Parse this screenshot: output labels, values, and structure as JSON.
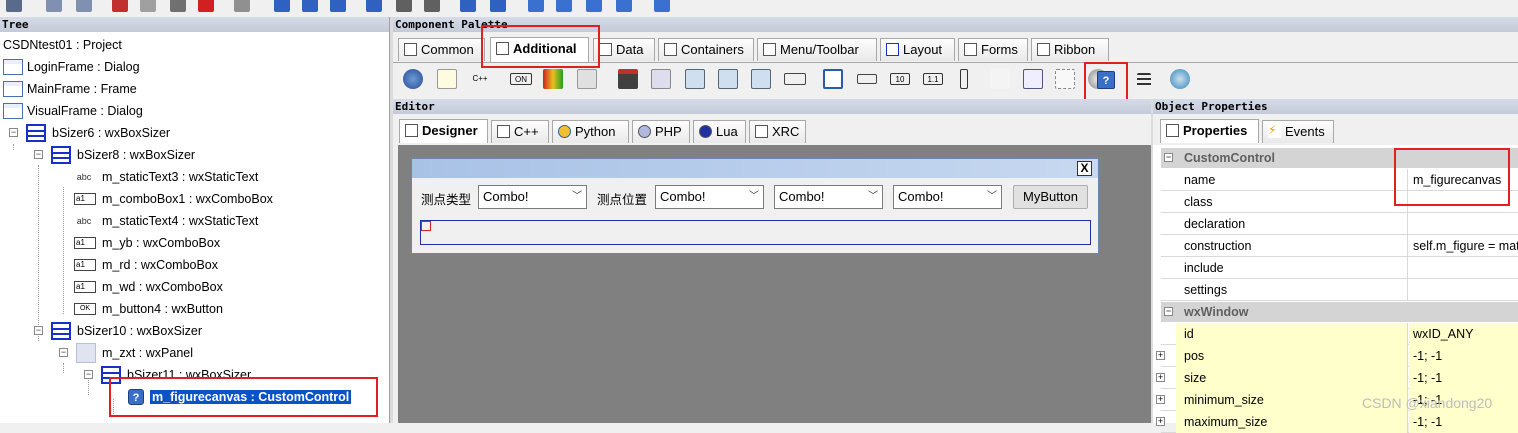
{
  "tree": {
    "header": "Tree",
    "rows": [
      {
        "label": "CSDNtest01 : Project"
      },
      {
        "label": "LoginFrame : Dialog"
      },
      {
        "label": "MainFrame : Frame"
      },
      {
        "label": "VisualFrame : Dialog"
      },
      {
        "label": "bSizer6 : wxBoxSizer"
      },
      {
        "label": "bSizer8 : wxBoxSizer"
      },
      {
        "label": "m_staticText3 : wxStaticText",
        "icon_text": "abc"
      },
      {
        "label": "m_comboBox1 : wxComboBox",
        "icon_text": "a1"
      },
      {
        "label": "m_staticText4 : wxStaticText",
        "icon_text": "abc"
      },
      {
        "label": "m_yb : wxComboBox",
        "icon_text": "a1"
      },
      {
        "label": "m_rd : wxComboBox",
        "icon_text": "a1"
      },
      {
        "label": "m_wd : wxComboBox",
        "icon_text": "a1"
      },
      {
        "label": "m_button4 : wxButton",
        "icon_text": "OK"
      },
      {
        "label": "bSizer10 : wxBoxSizer"
      },
      {
        "label": "m_zxt : wxPanel"
      },
      {
        "label": "bSizer11 : wxBoxSizer"
      },
      {
        "label": "m_figurecanvas : CustomControl"
      }
    ]
  },
  "palette": {
    "header": "Component Palette",
    "tabs": [
      "Common",
      "Additional",
      "Data",
      "Containers",
      "Menu/Toolbar",
      "Layout",
      "Forms",
      "Ribbon"
    ],
    "active_tab": "Additional",
    "small_icon_text": {
      "cpp": "C++",
      "on": "ON",
      "ten": "10",
      "one_one": "1.1"
    }
  },
  "editor": {
    "header": "Editor",
    "tabs": [
      "Designer",
      "C++",
      "Python",
      "PHP",
      "Lua",
      "XRC"
    ],
    "active_tab": "Designer",
    "form": {
      "close_glyph": "X",
      "label1": "测点类型",
      "label2": "测点位置",
      "combo1": "Combo!",
      "combo2": "Combo!",
      "combo3": "Combo!",
      "combo4": "Combo!",
      "button": "MyButton"
    }
  },
  "properties": {
    "header": "Object Properties",
    "tabs": [
      "Properties",
      "Events"
    ],
    "categories": [
      {
        "name": "CustomControl",
        "rows": [
          {
            "key": "name",
            "value": "m_figurecanvas"
          },
          {
            "key": "class",
            "value": ""
          },
          {
            "key": "declaration",
            "value": ""
          },
          {
            "key": "construction",
            "value": "self.m_figure = mat"
          },
          {
            "key": "include",
            "value": ""
          },
          {
            "key": "settings",
            "value": ""
          }
        ]
      },
      {
        "name": "wxWindow",
        "rows": [
          {
            "key": "id",
            "value": "wxID_ANY"
          },
          {
            "key": "pos",
            "value": "-1; -1"
          },
          {
            "key": "size",
            "value": "-1; -1"
          },
          {
            "key": "minimum_size",
            "value": "-1; -1"
          },
          {
            "key": "maximum_size",
            "value": "-1; -1"
          }
        ]
      }
    ]
  },
  "watermark": "CSDN @xiandong20",
  "colors": {
    "selection": "#0a52c8",
    "highlight_box": "#e02020",
    "yellow_row": "#ffffcc",
    "canvas": "#808080"
  }
}
